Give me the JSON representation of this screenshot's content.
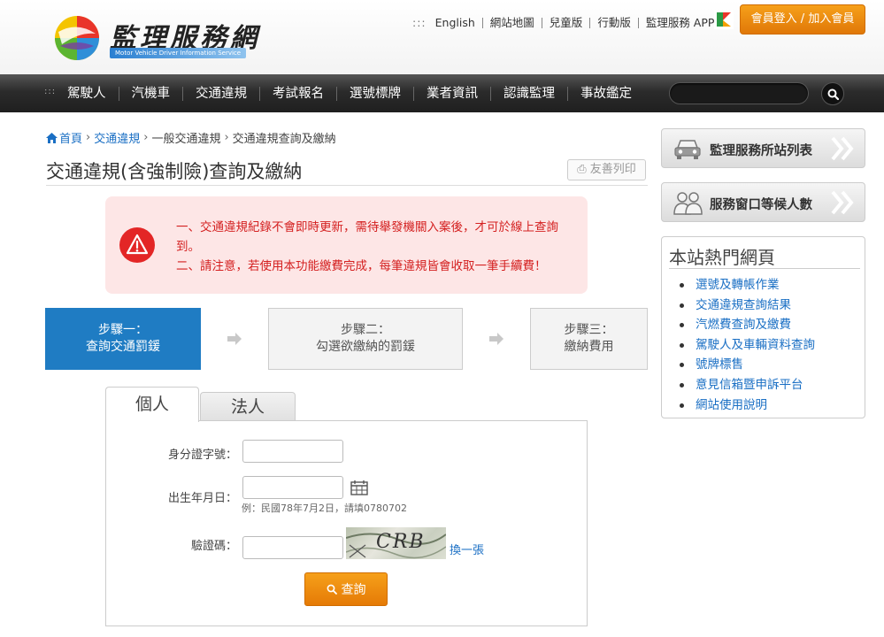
{
  "header": {
    "logo_title": "監理服務網",
    "logo_subtitle": "Motor Vehicle Driver Information Service",
    "top_links": [
      "English",
      "網站地圖",
      "兒童版",
      "行動版",
      "監理服務 APP"
    ],
    "login_label": "會員登入 / 加入會員"
  },
  "nav": {
    "items": [
      "駕駛人",
      "汽機車",
      "交通違規",
      "考試報名",
      "選號標牌",
      "業者資訊",
      "認識監理",
      "事故鑑定"
    ],
    "search_value": ""
  },
  "breadcrumb": {
    "home": "首頁",
    "items": [
      "交通違規",
      "一般交通違規",
      "交通違規查詢及繳納"
    ]
  },
  "page": {
    "title": "交通違規(含強制險)查詢及繳納",
    "print_label": "友善列印"
  },
  "notice": {
    "lines": [
      "一、交通違規紀錄不會即時更新，需待舉發機關入案後，才可於線上查詢到。",
      "二、請注意，若使用本功能繳費完成，每筆違規皆會收取一筆手續費！"
    ]
  },
  "steps": [
    {
      "title": "步驟一：",
      "desc": "查詢交通罰鍰"
    },
    {
      "title": "步驟二：",
      "desc": "勾選欲繳納的罰鍰"
    },
    {
      "title": "步驟三：",
      "desc": "繳納費用"
    }
  ],
  "tabs": [
    "個人",
    "法人"
  ],
  "form": {
    "id_label": "身分證字號：",
    "id_value": "",
    "birth_label": "出生年月日：",
    "birth_value": "",
    "birth_hint": "例：民國78年7月2日，請填0780702",
    "captcha_label": "驗證碼：",
    "captcha_value": "",
    "captcha_image_text": "CRB",
    "refresh_label": "換一張",
    "search_label": "查詢"
  },
  "sidebar": {
    "buttons": [
      "監理服務所站列表",
      "服務窗口等候人數"
    ],
    "hot_title": "本站熱門網頁",
    "hot_links": [
      "選號及轉帳作業",
      "交通違規查詢結果",
      "汽燃費查詢及繳費",
      "駕駛人及車輛資料查詢",
      "號牌標售",
      "意見信箱暨申訴平台",
      "網站使用說明"
    ]
  },
  "colors": {
    "accent_orange": "#f08a10",
    "step_blue": "#1f7cc3",
    "notice_red": "#d42020",
    "link_blue": "#1a6fc4"
  }
}
